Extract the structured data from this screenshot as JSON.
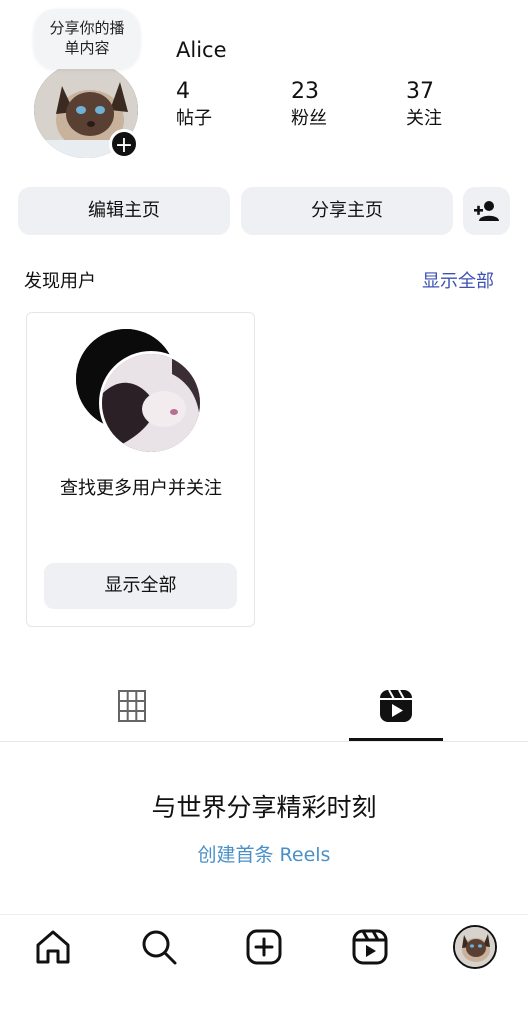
{
  "profile": {
    "note": "分享你的播单内容",
    "note_line1": "分享你的播",
    "note_line2": "单内容",
    "username": "Alice",
    "stats": [
      {
        "value": "4",
        "label": "帖子"
      },
      {
        "value": "23",
        "label": "粉丝"
      },
      {
        "value": "37",
        "label": "关注"
      }
    ]
  },
  "actions": {
    "edit_profile": "编辑主页",
    "share_profile": "分享主页",
    "add_person_icon": "add-person-icon"
  },
  "discover": {
    "title": "发现用户",
    "show_all": "显示全部",
    "card_text": "查找更多用户并关注",
    "card_button": "显示全部",
    "accent": "#3f51b5"
  },
  "tabs": [
    {
      "icon": "grid-icon",
      "selected": false
    },
    {
      "icon": "reels-icon",
      "selected": true
    }
  ],
  "empty_state": {
    "title": "与世界分享精彩时刻",
    "link": "创建首条 Reels",
    "link_color": "#4a90c8"
  },
  "bottom_nav": [
    {
      "icon": "home-icon"
    },
    {
      "icon": "search-icon"
    },
    {
      "icon": "create-icon"
    },
    {
      "icon": "reels-icon"
    },
    {
      "icon": "profile-avatar"
    }
  ]
}
